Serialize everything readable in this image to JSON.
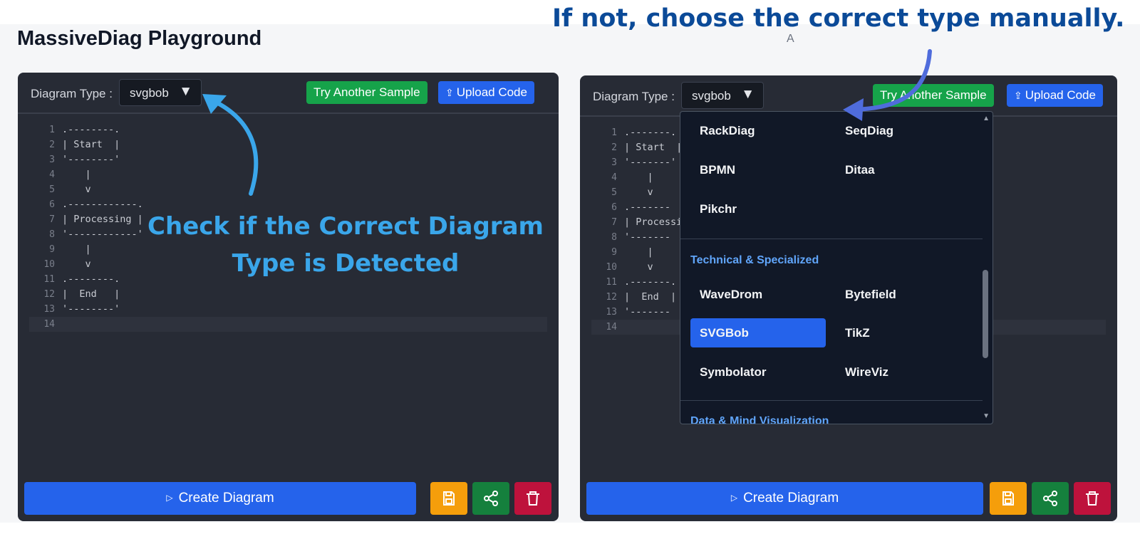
{
  "page": {
    "title": "MassiveDiag Playground",
    "stray_text": "A"
  },
  "annotations": {
    "top_callout": "If not, choose the correct type manually.",
    "left_callout": "Check if the Correct Diagram Type is Detected",
    "left_callout_color": "#3aa6ea",
    "top_callout_color": "#0b4a98"
  },
  "editor_panel": {
    "diagram_type_label": "Diagram Type :",
    "selected_type": "svgbob",
    "caret": "▼",
    "try_sample_label": "Try Another Sample",
    "upload_label": "Upload Code",
    "upload_icon": "⇪",
    "create_label": "Create Diagram",
    "create_icon": "▷",
    "code_lines": [
      ".--------.",
      "| Start  |",
      "'--------'",
      "    |",
      "    v",
      ".------------.",
      "| Processing |",
      "'------------'",
      "    |",
      "    v",
      ".--------.",
      "|  End   |",
      "'--------'",
      ""
    ],
    "right_code_lines": [
      ".-------.",
      "| Start  |",
      "'-------'",
      "    |",
      "    v",
      ".-------",
      "| Processi",
      "'-------",
      "    |",
      "    v",
      ".-------.",
      "|  End  |",
      "'-------",
      ""
    ]
  },
  "dropdown": {
    "items_group1": [
      "RackDiag",
      "SeqDiag",
      "BPMN",
      "Ditaa",
      "Pikchr"
    ],
    "section_technical": "Technical & Specialized",
    "items_technical": [
      "WaveDrom",
      "Bytefield",
      "SVGBob",
      "TikZ",
      "Symbolator",
      "WireViz"
    ],
    "selected_item": "SVGBob",
    "section_data": "Data & Mind Visualization",
    "scroll_up": "▲",
    "scroll_down": "▼"
  },
  "colors": {
    "accent_blue": "#2563eb",
    "green": "#16a34a",
    "amber": "#f59e0b",
    "crimson": "#be123c",
    "panel_bg": "#272b35"
  }
}
